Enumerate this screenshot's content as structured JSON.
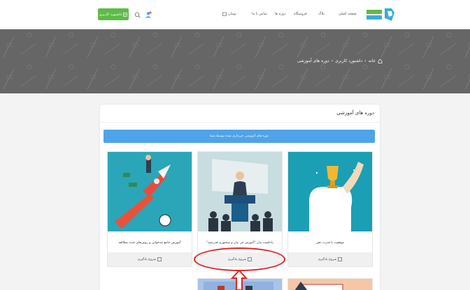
{
  "header": {
    "nav": [
      "صفحه اصلی",
      "بلاگ",
      "فروشگاه",
      "دوره ها",
      "تماس با ما",
      "۰ تومان"
    ],
    "dashboard_button": "داشبورد کاربری"
  },
  "breadcrumb": {
    "home": "خانه",
    "dashboard": "داشبورد کاربری",
    "current": "دوره های آموزشی",
    "separator": "›"
  },
  "panel": {
    "title": "دوره های آموزشی",
    "alert": "دوره های آموزشی خریداری شده توسط شما"
  },
  "courses": [
    {
      "title": "موفقیت با قدرت ذهن",
      "action": "شروع یادگیری"
    },
    {
      "title": "پادکست بیان \"آموزش فن بیان و سخنوری قدرتمند\"",
      "action": "شروع یادگیری"
    },
    {
      "title": "آموزش جامع تندخوانی و روش‌های جدید مطالعه",
      "action": "شروع یادگیری"
    }
  ],
  "colors": {
    "accent_green": "#5dbb46",
    "alert_blue": "#4fa3e8",
    "annotation_red": "#e02424",
    "banner_gray": "#6a6a6a"
  }
}
